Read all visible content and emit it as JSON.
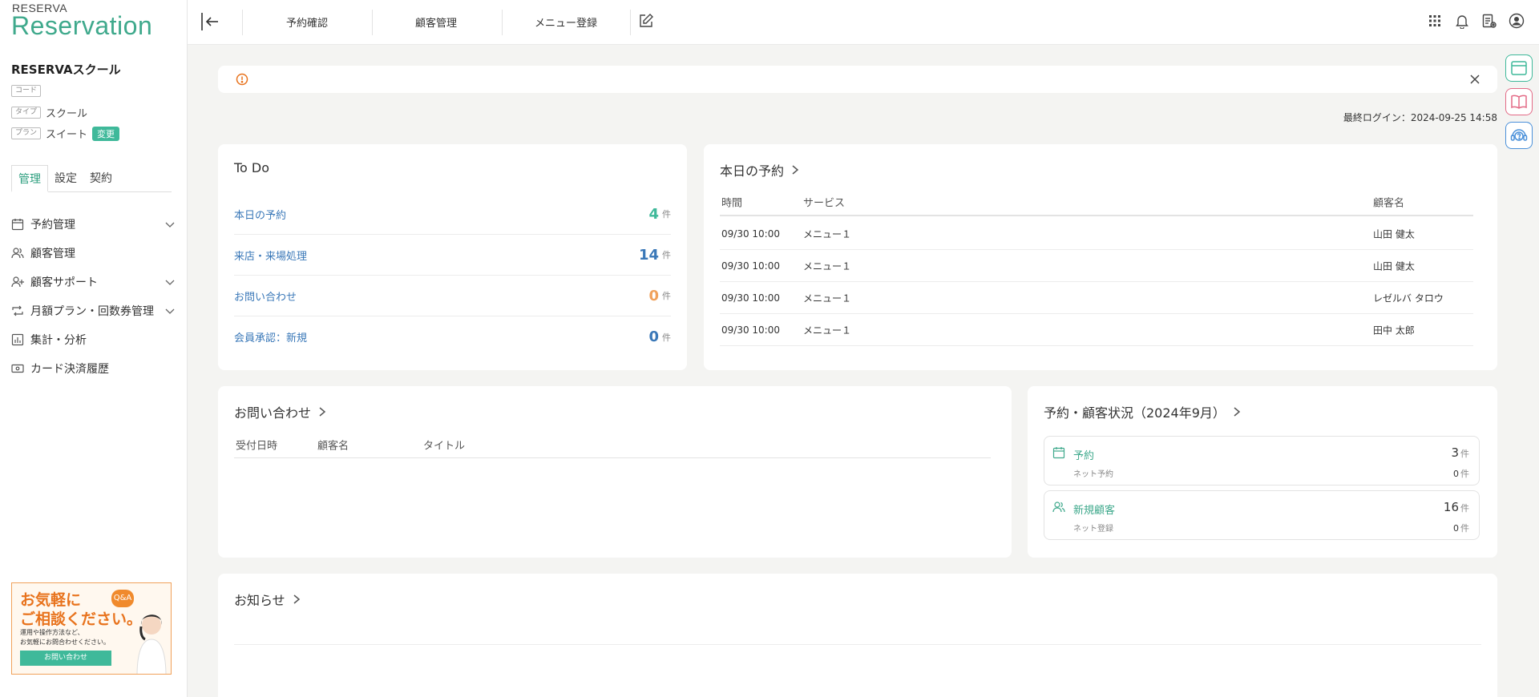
{
  "brand": {
    "small": "RESERVA",
    "big": "Reservation"
  },
  "account": {
    "name": "RESERVAスクール",
    "code_tag": "コード",
    "type_tag": "タイプ",
    "type_value": "スクール",
    "plan_tag": "プラン",
    "plan_value": "スイート",
    "change_label": "変更"
  },
  "side_tabs": [
    "管理",
    "設定",
    "契約"
  ],
  "nav": [
    {
      "label": "予約管理",
      "icon": "calendar-icon",
      "expandable": true
    },
    {
      "label": "顧客管理",
      "icon": "users-icon",
      "expandable": false
    },
    {
      "label": "顧客サポート",
      "icon": "user-plus-icon",
      "expandable": true
    },
    {
      "label": "月額プラン・回数券管理",
      "icon": "repeat-icon",
      "expandable": true
    },
    {
      "label": "集計・分析",
      "icon": "chart-icon",
      "expandable": false
    },
    {
      "label": "カード決済履歴",
      "icon": "card-icon",
      "expandable": false
    }
  ],
  "promo": {
    "line1": "お気軽に",
    "line2": "ご相談ください。",
    "qa": "Q&A",
    "sub1": "運用や操作方法など、",
    "sub2": "お気軽にお問合わせください。",
    "button": "お問い合わせ"
  },
  "header": {
    "links": [
      "予約確認",
      "顧客管理",
      "メニュー登録"
    ]
  },
  "last_login": "最終ログイン：2024-09-25 14:58",
  "todo": {
    "title": "To Do",
    "unit": "件",
    "items": [
      {
        "label": "本日の予約",
        "count": "4",
        "color": "#3fb99a"
      },
      {
        "label": "来店・来場処理",
        "count": "14",
        "color": "#3a78b8"
      },
      {
        "label": "お問い合わせ",
        "count": "0",
        "color": "#f0a15a"
      },
      {
        "label": "会員承認：新規",
        "count": "0",
        "color": "#3a78b8"
      }
    ]
  },
  "today": {
    "title": "本日の予約",
    "headers": [
      "時間",
      "サービス",
      "顧客名"
    ],
    "rows": [
      {
        "time": "09/30 10:00",
        "service": "メニュー１",
        "customer": "山田 健太"
      },
      {
        "time": "09/30 10:00",
        "service": "メニュー１",
        "customer": "山田 健太"
      },
      {
        "time": "09/30 10:00",
        "service": "メニュー１",
        "customer": "レゼルバ タロウ"
      },
      {
        "time": "09/30 10:00",
        "service": "メニュー１",
        "customer": "田中 太郎"
      }
    ]
  },
  "inquiry": {
    "title": "お問い合わせ",
    "headers": [
      "受付日時",
      "顧客名",
      "タイトル"
    ]
  },
  "status": {
    "title": "予約・顧客状況（2024年9月）",
    "unit": "件",
    "boxes": [
      {
        "label": "予約",
        "sub": "ネット予約",
        "value": "3",
        "sub_value": "0"
      },
      {
        "label": "新規顧客",
        "sub": "ネット登録",
        "value": "16",
        "sub_value": "0"
      }
    ]
  },
  "news": {
    "title": "お知らせ"
  }
}
